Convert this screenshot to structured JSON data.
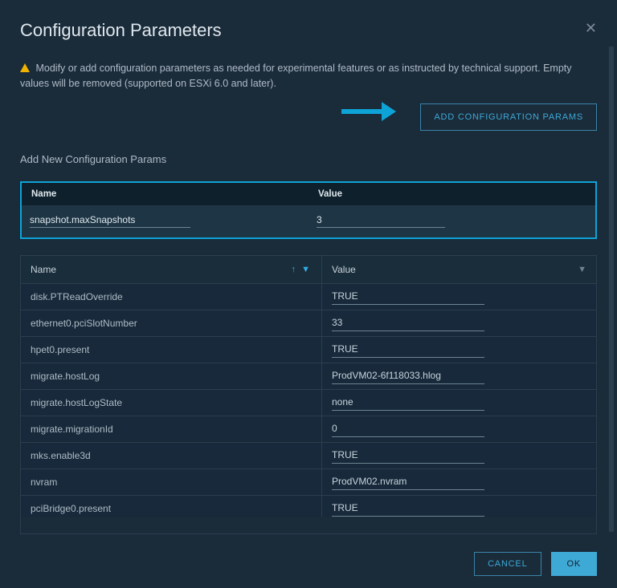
{
  "dialog": {
    "title": "Configuration Parameters",
    "notice": "Modify or add configuration parameters as needed for experimental features or as instructed by technical support. Empty values will be removed (supported on ESXi 6.0 and later).",
    "addButton": "ADD CONFIGURATION PARAMS",
    "sectionLabel": "Add New Configuration Params",
    "newParam": {
      "nameHeader": "Name",
      "valueHeader": "Value",
      "nameValue": "snapshot.maxSnapshots",
      "valueValue": "3"
    },
    "grid": {
      "nameHeader": "Name",
      "valueHeader": "Value",
      "rows": [
        {
          "name": "disk.PTReadOverride",
          "value": "TRUE"
        },
        {
          "name": "ethernet0.pciSlotNumber",
          "value": "33"
        },
        {
          "name": "hpet0.present",
          "value": "TRUE"
        },
        {
          "name": "migrate.hostLog",
          "value": "ProdVM02-6f118033.hlog"
        },
        {
          "name": "migrate.hostLogState",
          "value": "none"
        },
        {
          "name": "migrate.migrationId",
          "value": "0"
        },
        {
          "name": "mks.enable3d",
          "value": "TRUE"
        },
        {
          "name": "nvram",
          "value": "ProdVM02.nvram"
        },
        {
          "name": "pciBridge0.present",
          "value": "TRUE"
        }
      ]
    },
    "buttons": {
      "cancel": "CANCEL",
      "ok": "OK"
    }
  }
}
